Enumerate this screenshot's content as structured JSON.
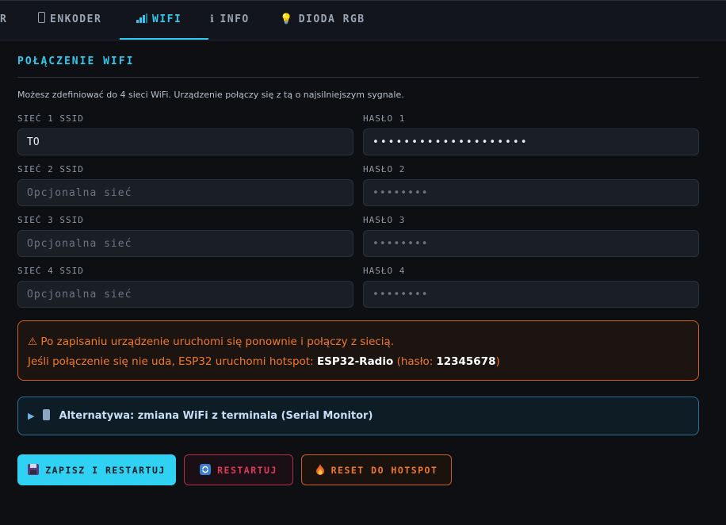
{
  "tabs": [
    {
      "icon": "",
      "label": "R"
    },
    {
      "icon": "▯",
      "label": "ENKODER"
    },
    {
      "icon": "▂▄▆",
      "label": "WIFI"
    },
    {
      "icon": "ℹ",
      "label": "INFO"
    },
    {
      "icon": "💡",
      "label": "DIODA RGB"
    }
  ],
  "active_tab": "WIFI",
  "section": {
    "title": "POŁĄCZENIE WIFI",
    "description": "Możesz zdefiniować do 4 sieci WiFi. Urządzenie połączy się z tą o najsilniejszym sygnale."
  },
  "networks": [
    {
      "ssid_label": "SIEĆ 1 SSID",
      "ssid_value": "TO",
      "ssid_placeholder": "",
      "pass_label": "HASŁO 1",
      "pass_value": "••••••••••••••••••••",
      "pass_placeholder": ""
    },
    {
      "ssid_label": "SIEĆ 2 SSID",
      "ssid_value": "",
      "ssid_placeholder": "Opcjonalna sieć",
      "pass_label": "HASŁO 2",
      "pass_value": "",
      "pass_placeholder": "••••••••"
    },
    {
      "ssid_label": "SIEĆ 3 SSID",
      "ssid_value": "",
      "ssid_placeholder": "Opcjonalna sieć",
      "pass_label": "HASŁO 3",
      "pass_value": "",
      "pass_placeholder": "••••••••"
    },
    {
      "ssid_label": "SIEĆ 4 SSID",
      "ssid_value": "",
      "ssid_placeholder": "Opcjonalna sieć",
      "pass_label": "HASŁO 4",
      "pass_value": "",
      "pass_placeholder": "••••••••"
    }
  ],
  "warning": {
    "icon": "⚠",
    "line1": "Po zapisaniu urządzenie uruchomi się ponownie i połączy z siecią.",
    "line2_prefix": "Jeśli połączenie się nie uda, ESP32 uruchomi hotspot:",
    "hotspot_name": "ESP32-Radio",
    "pass_prefix": "(hasło:",
    "hotspot_pass": "12345678",
    "pass_suffix": ")"
  },
  "alternative": {
    "label": "Alternatywa: zmiana WiFi z terminala (Serial Monitor)"
  },
  "buttons": {
    "save": "ZAPISZ I RESTARTUJ",
    "restart": "RESTARTUJ",
    "reset": "RESET DO HOTSPOT"
  },
  "colors": {
    "accent": "#2fc7ee",
    "warning": "#ee7a2a",
    "danger": "#e0385a",
    "background": "#0d0f13"
  }
}
